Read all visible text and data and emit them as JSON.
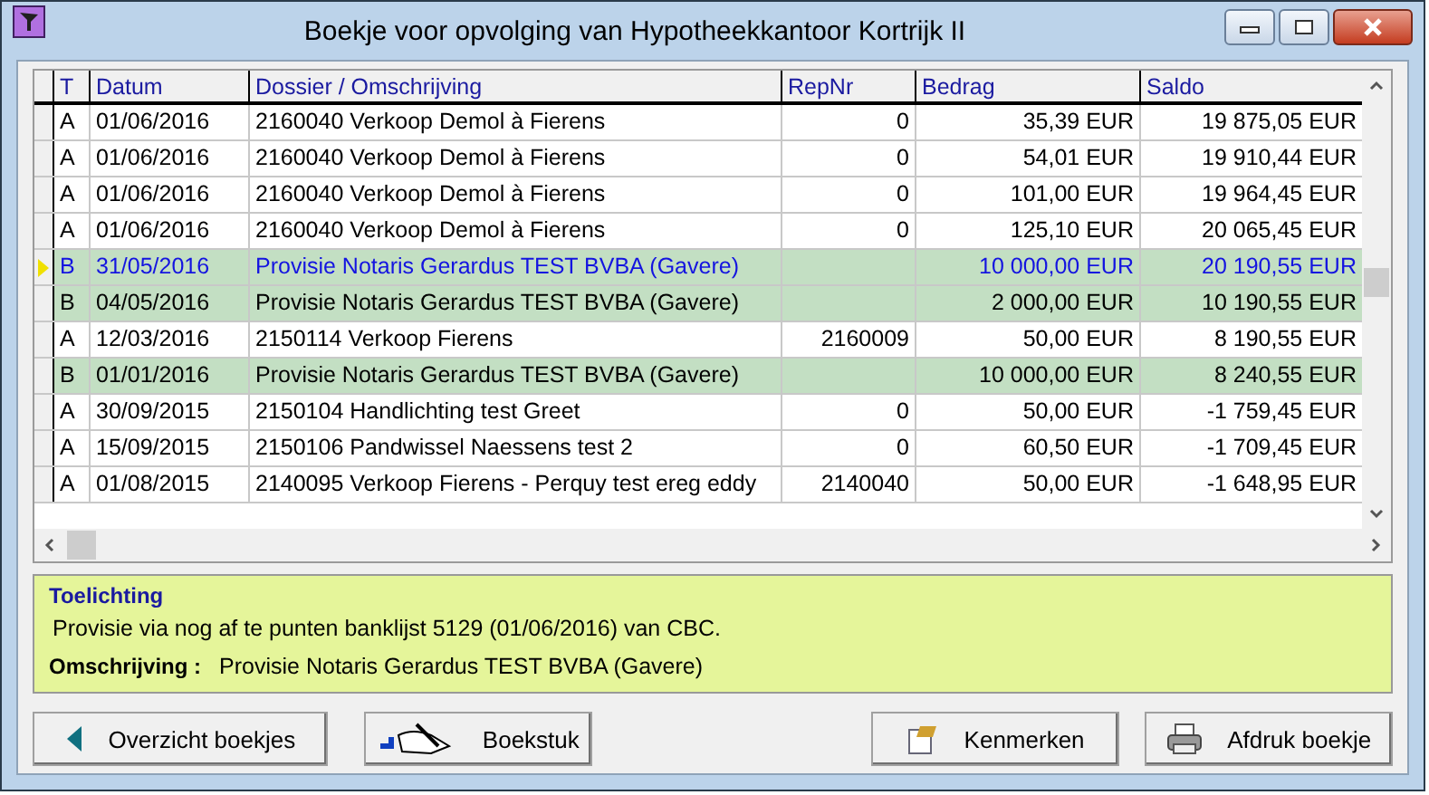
{
  "window": {
    "title": "Boekje voor opvolging van Hypotheekkantoor Kortrijk II"
  },
  "table": {
    "columns": [
      "T",
      "Datum",
      "Dossier / Omschrijving",
      "RepNr",
      "Bedrag",
      "Saldo"
    ],
    "rows": [
      {
        "cells": [
          "A",
          "01/06/2016",
          "2160040 Verkoop Demol à Fierens",
          "0",
          "35,39 EUR",
          "19 875,05 EUR"
        ],
        "shaded": false,
        "selected": false
      },
      {
        "cells": [
          "A",
          "01/06/2016",
          "2160040 Verkoop Demol à Fierens",
          "0",
          "54,01 EUR",
          "19 910,44 EUR"
        ],
        "shaded": false,
        "selected": false
      },
      {
        "cells": [
          "A",
          "01/06/2016",
          "2160040 Verkoop Demol à Fierens",
          "0",
          "101,00 EUR",
          "19 964,45 EUR"
        ],
        "shaded": false,
        "selected": false
      },
      {
        "cells": [
          "A",
          "01/06/2016",
          "2160040 Verkoop Demol à Fierens",
          "0",
          "125,10 EUR",
          "20 065,45 EUR"
        ],
        "shaded": false,
        "selected": false
      },
      {
        "cells": [
          "B",
          "31/05/2016",
          "Provisie Notaris Gerardus TEST BVBA (Gavere)",
          "",
          "10 000,00 EUR",
          "20 190,55 EUR"
        ],
        "shaded": true,
        "selected": true
      },
      {
        "cells": [
          "B",
          "04/05/2016",
          "Provisie Notaris Gerardus TEST BVBA (Gavere)",
          "",
          "2 000,00 EUR",
          "10 190,55 EUR"
        ],
        "shaded": true,
        "selected": false
      },
      {
        "cells": [
          "A",
          "12/03/2016",
          "2150114 Verkoop Fierens",
          "2160009",
          "50,00 EUR",
          "8 190,55 EUR"
        ],
        "shaded": false,
        "selected": false
      },
      {
        "cells": [
          "B",
          "01/01/2016",
          "Provisie Notaris Gerardus TEST BVBA (Gavere)",
          "",
          "10 000,00 EUR",
          "8 240,55 EUR"
        ],
        "shaded": true,
        "selected": false
      },
      {
        "cells": [
          "A",
          "30/09/2015",
          "2150104 Handlichting test Greet",
          "0",
          "50,00 EUR",
          "-1 759,45 EUR"
        ],
        "shaded": false,
        "selected": false
      },
      {
        "cells": [
          "A",
          "15/09/2015",
          "2150106 Pandwissel Naessens test 2",
          "0",
          "60,50 EUR",
          "-1 709,45 EUR"
        ],
        "shaded": false,
        "selected": false
      },
      {
        "cells": [
          "A",
          "01/08/2015",
          "2140095 Verkoop Fierens - Perquy  test ereg eddy",
          "2140040",
          "50,00 EUR",
          "-1 648,95 EUR"
        ],
        "shaded": false,
        "selected": false
      }
    ]
  },
  "details": {
    "heading": "Toelichting",
    "note": "Provisie via nog af te punten banklijst 5129 (01/06/2016) van CBC.",
    "label": "Omschrijving :",
    "value": "Provisie Notaris Gerardus TEST BVBA (Gavere)"
  },
  "buttons": [
    {
      "kind": "back",
      "label": "Overzicht boekjes"
    },
    {
      "kind": "document",
      "label": "Boekstuk"
    },
    {
      "kind": "properties",
      "label": "Kenmerken"
    },
    {
      "kind": "print",
      "label": "Afdruk boekje"
    }
  ]
}
